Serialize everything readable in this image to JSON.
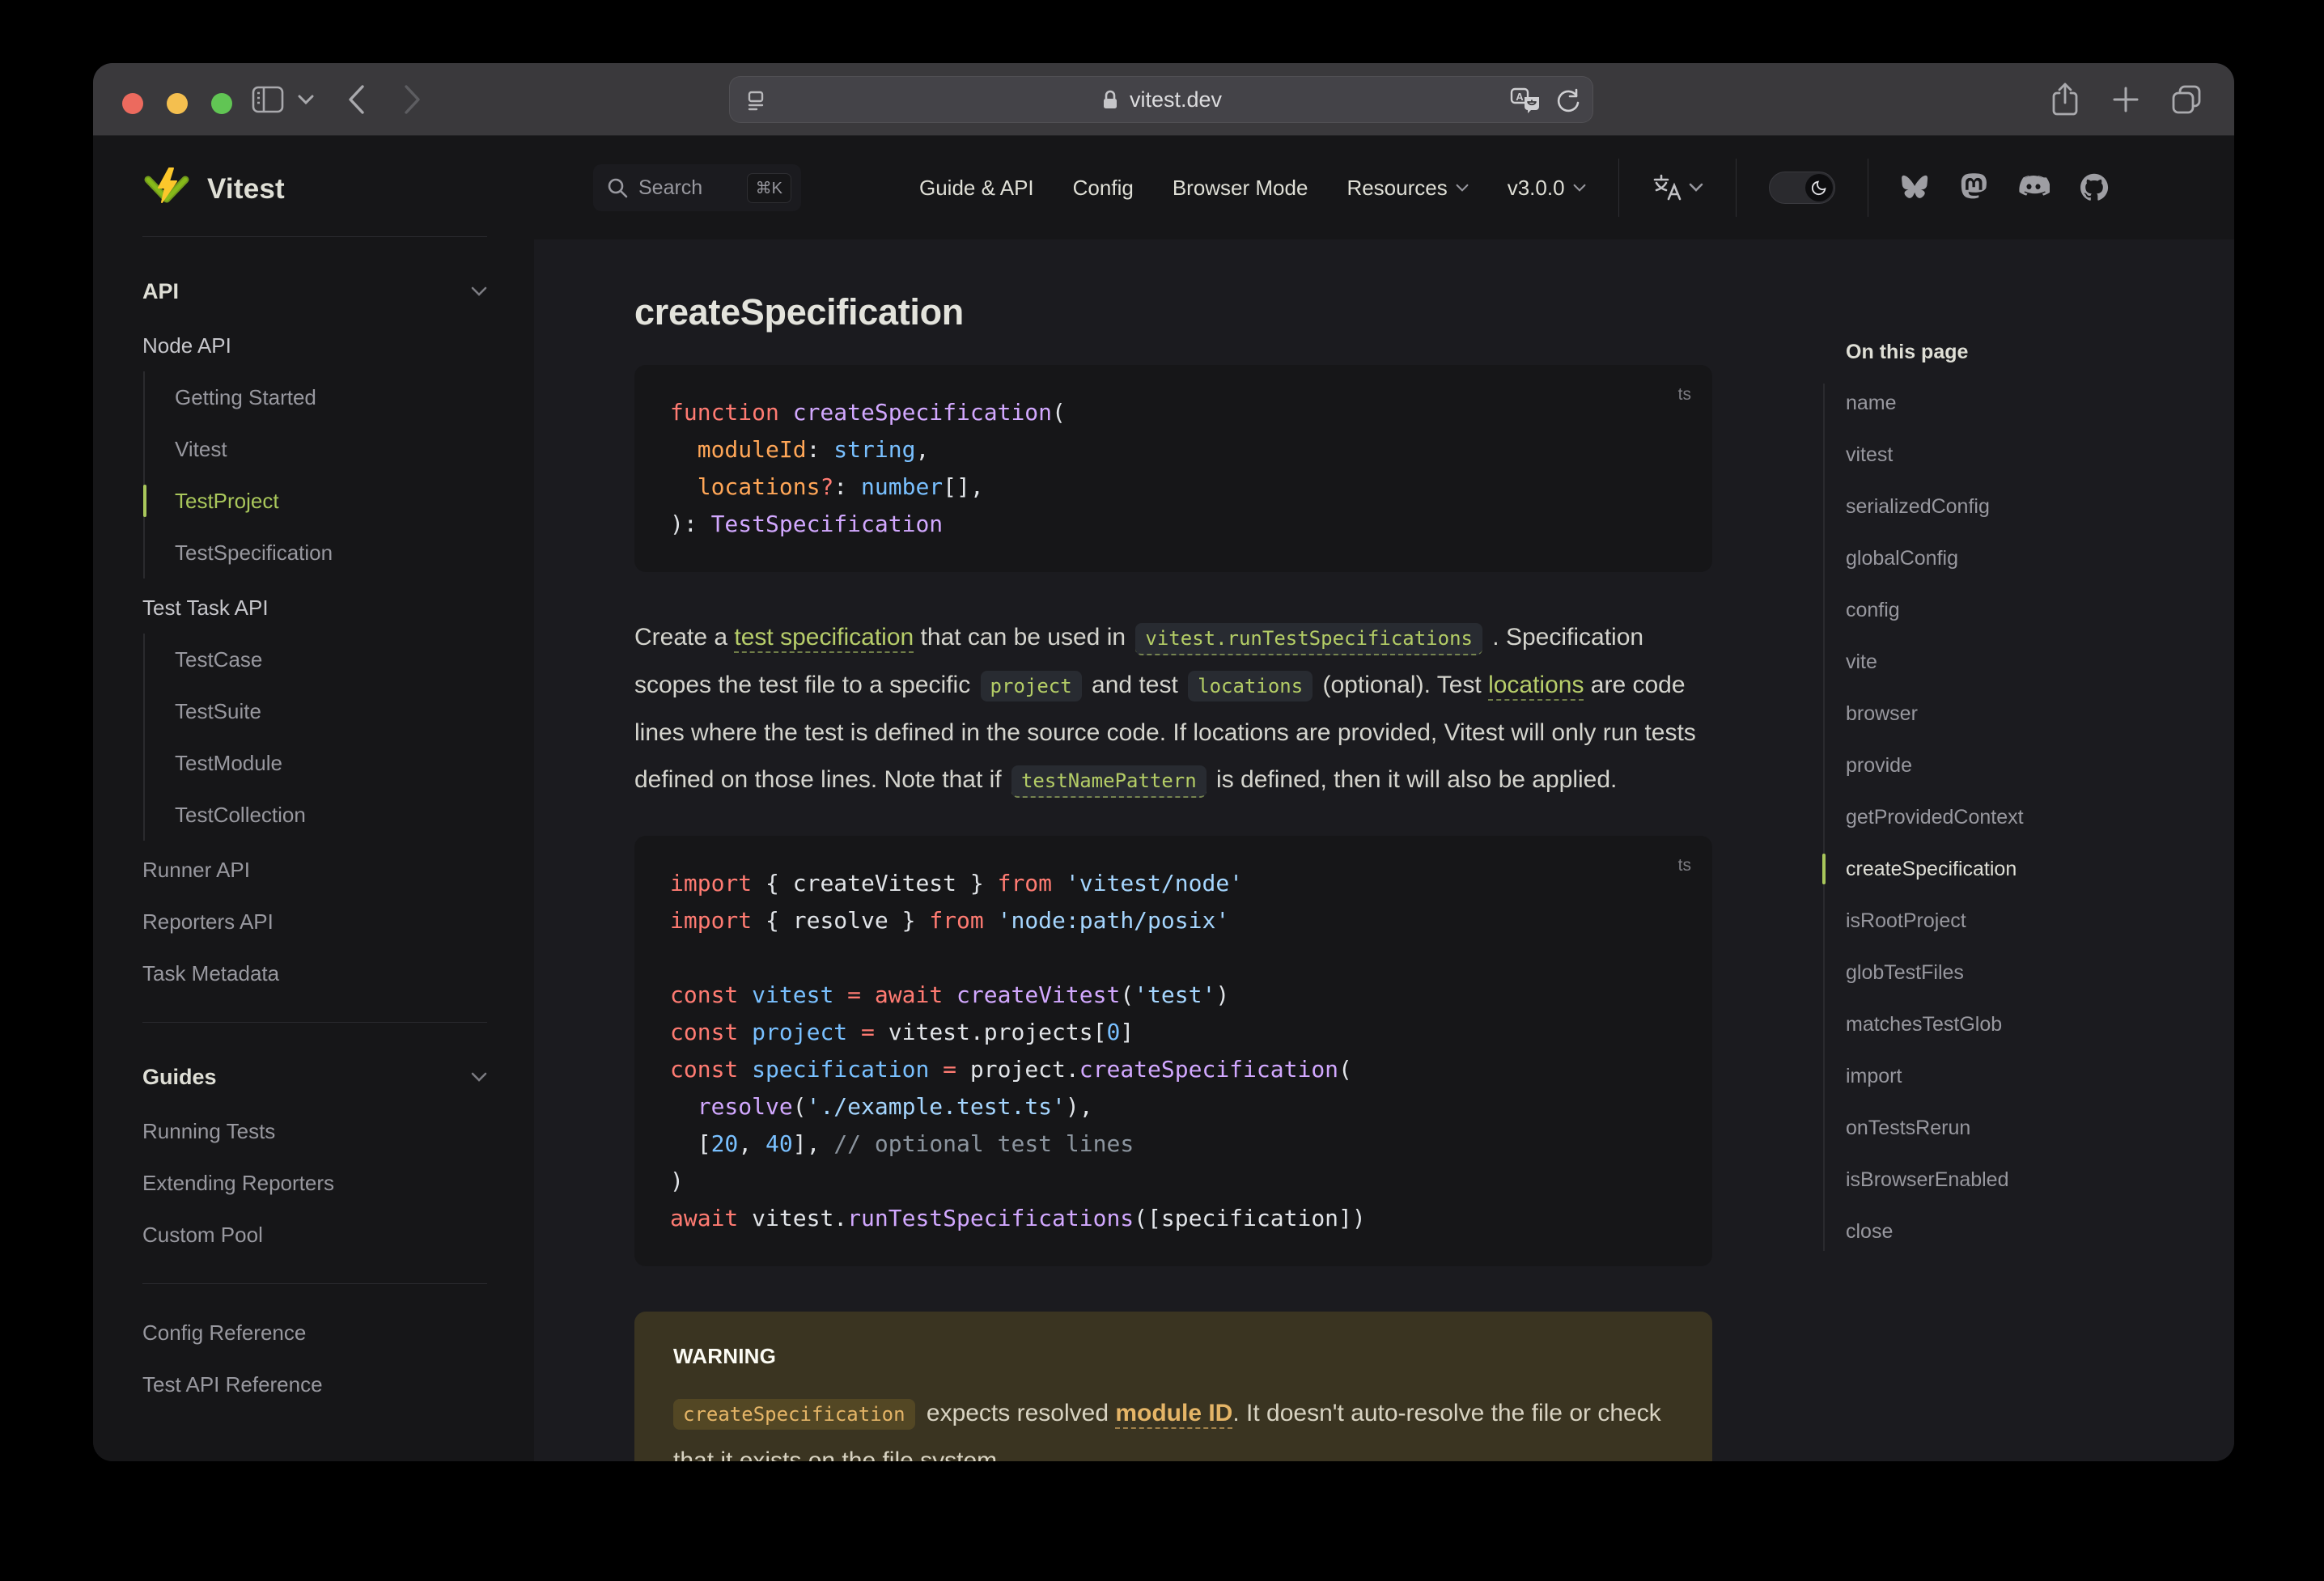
{
  "browser": {
    "url": "vitest.dev",
    "icons": [
      "sidebar-toggle-icon",
      "tab-overview-chevron-icon",
      "back-icon",
      "forward-icon",
      "reader-icon",
      "lock-icon",
      "translate-icon",
      "reload-icon",
      "share-icon",
      "new-tab-icon",
      "tabs-icon"
    ]
  },
  "navbar": {
    "search_label": "Search",
    "search_kbd": "⌘K",
    "links": [
      {
        "label": "Guide & API",
        "chevron": false
      },
      {
        "label": "Config",
        "chevron": false
      },
      {
        "label": "Browser Mode",
        "chevron": false
      },
      {
        "label": "Resources",
        "chevron": true
      },
      {
        "label": "v3.0.0",
        "chevron": true
      }
    ],
    "icons": [
      "language-icon",
      "theme-toggle-moon-icon",
      "bluesky-icon",
      "mastodon-icon",
      "discord-icon",
      "github-icon"
    ]
  },
  "sidebar": {
    "brand": "Vitest",
    "blocks": [
      {
        "type": "header",
        "label": "API"
      },
      {
        "type": "group",
        "label": "Node API"
      },
      {
        "type": "subitems",
        "items": [
          {
            "label": "Getting Started",
            "active": false
          },
          {
            "label": "Vitest",
            "active": false
          },
          {
            "label": "TestProject",
            "active": true
          },
          {
            "label": "TestSpecification",
            "active": false
          }
        ]
      },
      {
        "type": "group",
        "label": "Test Task API"
      },
      {
        "type": "subitems",
        "items": [
          {
            "label": "TestCase",
            "active": false
          },
          {
            "label": "TestSuite",
            "active": false
          },
          {
            "label": "TestModule",
            "active": false
          },
          {
            "label": "TestCollection",
            "active": false
          }
        ]
      },
      {
        "type": "link",
        "label": "Runner API"
      },
      {
        "type": "link",
        "label": "Reporters API"
      },
      {
        "type": "link",
        "label": "Task Metadata"
      },
      {
        "type": "divider"
      },
      {
        "type": "header",
        "label": "Guides"
      },
      {
        "type": "link",
        "label": "Running Tests"
      },
      {
        "type": "link",
        "label": "Extending Reporters"
      },
      {
        "type": "link",
        "label": "Custom Pool"
      },
      {
        "type": "divider"
      },
      {
        "type": "link",
        "label": "Config Reference"
      },
      {
        "type": "link",
        "label": "Test API Reference"
      }
    ]
  },
  "content": {
    "heading": "createSpecification",
    "code1": {
      "lang": "ts",
      "lines": [
        [
          {
            "t": "function",
            "c": "kw"
          },
          {
            "t": " ",
            "c": "pl"
          },
          {
            "t": "createSpecification",
            "c": "fn"
          },
          {
            "t": "(",
            "c": "pl"
          }
        ],
        [
          {
            "t": "  ",
            "c": "pl"
          },
          {
            "t": "moduleId",
            "c": "prm"
          },
          {
            "t": ":",
            "c": "pl"
          },
          {
            "t": " ",
            "c": "pl"
          },
          {
            "t": "string",
            "c": "var"
          },
          {
            "t": ",",
            "c": "pl"
          }
        ],
        [
          {
            "t": "  ",
            "c": "pl"
          },
          {
            "t": "locations",
            "c": "prm"
          },
          {
            "t": "?",
            "c": "kw"
          },
          {
            "t": ":",
            "c": "pl"
          },
          {
            "t": " ",
            "c": "pl"
          },
          {
            "t": "number",
            "c": "var"
          },
          {
            "t": "[],",
            "c": "pl"
          }
        ],
        [
          {
            "t": "):",
            "c": "pl"
          },
          {
            "t": " ",
            "c": "pl"
          },
          {
            "t": "TestSpecification",
            "c": "fn"
          }
        ]
      ]
    },
    "paragraph": [
      {
        "k": "text",
        "t": "Create a "
      },
      {
        "k": "link",
        "t": "test specification"
      },
      {
        "k": "text",
        "t": " that can be used in "
      },
      {
        "k": "codelink",
        "t": "vitest.runTestSpecifications"
      },
      {
        "k": "text",
        "t": " . Specification scopes the test file to a specific "
      },
      {
        "k": "code",
        "t": "project"
      },
      {
        "k": "text",
        "t": " and test "
      },
      {
        "k": "code",
        "t": "locations"
      },
      {
        "k": "text",
        "t": " (optional). Test "
      },
      {
        "k": "link",
        "t": "locations"
      },
      {
        "k": "text",
        "t": " are code lines where the test is defined in the source code. If locations are provided, Vitest will only run tests defined on those lines. Note that if "
      },
      {
        "k": "codelink",
        "t": "testNamePattern"
      },
      {
        "k": "text",
        "t": " is defined, then it will also be applied."
      }
    ],
    "code2": {
      "lang": "ts",
      "lines": [
        [
          {
            "t": "import",
            "c": "kw"
          },
          {
            "t": " { createVitest } ",
            "c": "pl"
          },
          {
            "t": "from",
            "c": "kw"
          },
          {
            "t": " ",
            "c": "pl"
          },
          {
            "t": "'vitest/node'",
            "c": "str"
          }
        ],
        [
          {
            "t": "import",
            "c": "kw"
          },
          {
            "t": " { resolve } ",
            "c": "pl"
          },
          {
            "t": "from",
            "c": "kw"
          },
          {
            "t": " ",
            "c": "pl"
          },
          {
            "t": "'node:path/posix'",
            "c": "str"
          }
        ],
        [],
        [
          {
            "t": "const",
            "c": "kw"
          },
          {
            "t": " ",
            "c": "pl"
          },
          {
            "t": "vitest",
            "c": "var"
          },
          {
            "t": " ",
            "c": "pl"
          },
          {
            "t": "=",
            "c": "kw"
          },
          {
            "t": " ",
            "c": "pl"
          },
          {
            "t": "await",
            "c": "kw"
          },
          {
            "t": " ",
            "c": "pl"
          },
          {
            "t": "createVitest",
            "c": "fn"
          },
          {
            "t": "(",
            "c": "pl"
          },
          {
            "t": "'test'",
            "c": "str"
          },
          {
            "t": ")",
            "c": "pl"
          }
        ],
        [
          {
            "t": "const",
            "c": "kw"
          },
          {
            "t": " ",
            "c": "pl"
          },
          {
            "t": "project",
            "c": "var"
          },
          {
            "t": " ",
            "c": "pl"
          },
          {
            "t": "=",
            "c": "kw"
          },
          {
            "t": " vitest.projects[",
            "c": "pl"
          },
          {
            "t": "0",
            "c": "var"
          },
          {
            "t": "]",
            "c": "pl"
          }
        ],
        [
          {
            "t": "const",
            "c": "kw"
          },
          {
            "t": " ",
            "c": "pl"
          },
          {
            "t": "specification",
            "c": "var"
          },
          {
            "t": " ",
            "c": "pl"
          },
          {
            "t": "=",
            "c": "kw"
          },
          {
            "t": " project.",
            "c": "pl"
          },
          {
            "t": "createSpecification",
            "c": "fn"
          },
          {
            "t": "(",
            "c": "pl"
          }
        ],
        [
          {
            "t": "  ",
            "c": "pl"
          },
          {
            "t": "resolve",
            "c": "fn"
          },
          {
            "t": "(",
            "c": "pl"
          },
          {
            "t": "'./example.test.ts'",
            "c": "str"
          },
          {
            "t": "),",
            "c": "pl"
          }
        ],
        [
          {
            "t": "  [",
            "c": "pl"
          },
          {
            "t": "20",
            "c": "var"
          },
          {
            "t": ", ",
            "c": "pl"
          },
          {
            "t": "40",
            "c": "var"
          },
          {
            "t": "], ",
            "c": "pl"
          },
          {
            "t": "// optional test lines",
            "c": "cm"
          }
        ],
        [
          {
            "t": ")",
            "c": "pl"
          }
        ],
        [
          {
            "t": "await",
            "c": "kw"
          },
          {
            "t": " vitest.",
            "c": "pl"
          },
          {
            "t": "runTestSpecifications",
            "c": "fn"
          },
          {
            "t": "([specification])",
            "c": "pl"
          }
        ]
      ]
    },
    "warning": {
      "title": "WARNING",
      "segments": [
        {
          "k": "wcode",
          "t": "createSpecification"
        },
        {
          "k": "text",
          "t": " expects resolved "
        },
        {
          "k": "wlink",
          "t": "module ID"
        },
        {
          "k": "text",
          "t": ". It doesn't auto-resolve the file or check that it exists on the file system."
        }
      ]
    }
  },
  "toc": {
    "title": "On this page",
    "items": [
      {
        "label": "name",
        "active": false
      },
      {
        "label": "vitest",
        "active": false
      },
      {
        "label": "serializedConfig",
        "active": false
      },
      {
        "label": "globalConfig",
        "active": false
      },
      {
        "label": "config",
        "active": false
      },
      {
        "label": "vite",
        "active": false
      },
      {
        "label": "browser",
        "active": false
      },
      {
        "label": "provide",
        "active": false
      },
      {
        "label": "getProvidedContext",
        "active": false
      },
      {
        "label": "createSpecification",
        "active": true
      },
      {
        "label": "isRootProject",
        "active": false
      },
      {
        "label": "globTestFiles",
        "active": false
      },
      {
        "label": "matchesTestGlob",
        "active": false
      },
      {
        "label": "import",
        "active": false
      },
      {
        "label": "onTestsRerun",
        "active": false
      },
      {
        "label": "isBrowserEnabled",
        "active": false
      },
      {
        "label": "close",
        "active": false
      }
    ]
  },
  "colors": {
    "brand_green": "#a9c75b",
    "link_green": "#b7cd6a",
    "traffic_red": "#ec6a5e",
    "traffic_yellow": "#f4bf4f",
    "traffic_green": "#61c554",
    "code_keyword": "#ff7b72",
    "code_function": "#d2a8ff",
    "code_variable": "#79c0ff",
    "code_string": "#a5d6ff",
    "code_param": "#ffa657",
    "code_comment": "#8b949e",
    "warning_bg": "#3a3421",
    "warning_accent": "#e5b567",
    "page_bg": "#1b1b1f",
    "panel_bg": "#161618"
  }
}
